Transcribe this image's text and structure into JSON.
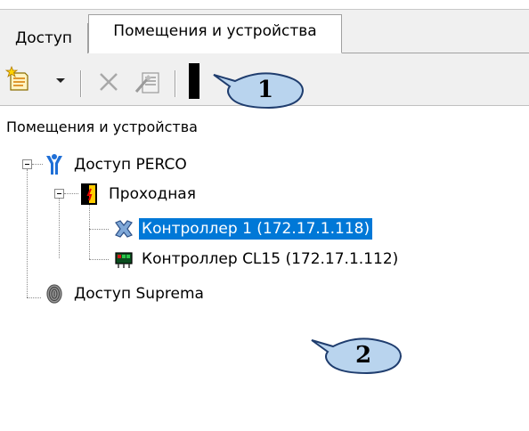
{
  "tabs": [
    {
      "label": "Доступ"
    },
    {
      "label": "Помещения и устройства"
    }
  ],
  "toolbar": {
    "add_icon": "add-element-icon",
    "dropdown_icon": "chevron-down-icon",
    "delete_icon": "delete-x-icon",
    "properties_icon": "properties-icon"
  },
  "callouts": [
    "1",
    "2"
  ],
  "panel": {
    "title": "Помещения и устройства"
  },
  "tree": {
    "items": [
      {
        "label": "Доступ PERCO",
        "icon": "perco-access-icon"
      },
      {
        "label": "Проходная",
        "icon": "checkpoint-door-icon"
      },
      {
        "label": "Контроллер 1 (172.17.1.118)",
        "icon": "controller-offline-icon",
        "selected": true
      },
      {
        "label": "Контроллер CL15 (172.17.1.112)",
        "icon": "controller-online-icon"
      },
      {
        "label": "Доступ Suprema",
        "icon": "fingerprint-icon"
      }
    ]
  },
  "colors": {
    "selection": "#0078d7",
    "callout_fill": "#b9d4ee",
    "callout_stroke": "#1f3d6e"
  }
}
